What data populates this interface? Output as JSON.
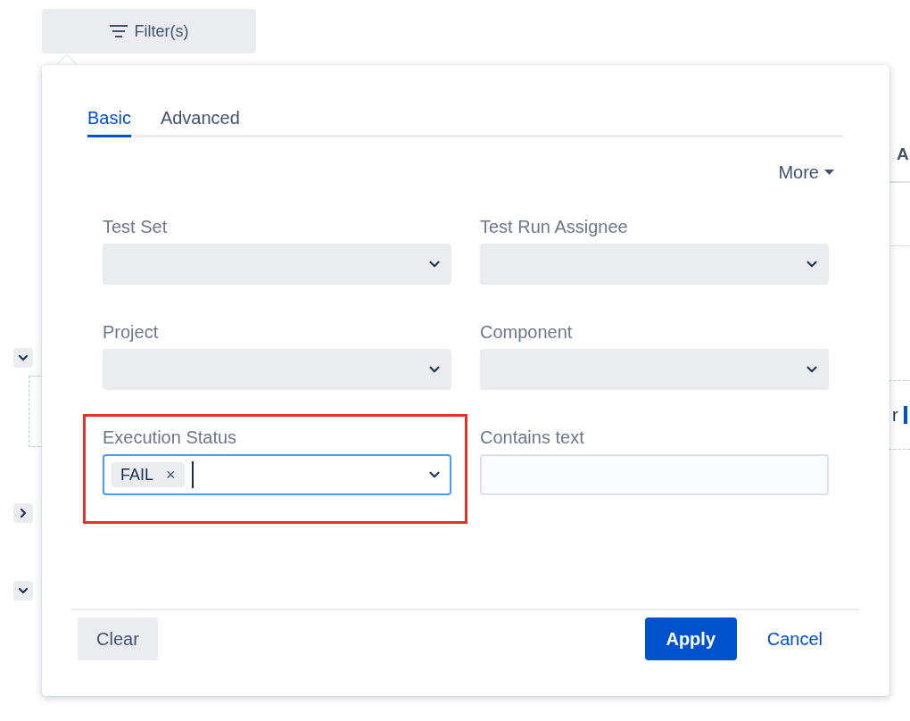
{
  "filter_button": {
    "label": "Filter(s)"
  },
  "background": {
    "column_header": "A",
    "text": "r",
    "row_toggles": [
      {
        "expanded": true
      },
      {
        "expanded": false
      },
      {
        "expanded": true
      }
    ]
  },
  "popover": {
    "tabs": [
      {
        "label": "Basic",
        "selected": true
      },
      {
        "label": "Advanced",
        "selected": false
      }
    ],
    "more": "More",
    "fields": [
      {
        "label": "Test Set",
        "kind": "select"
      },
      {
        "label": "Test Run Assignee",
        "kind": "select"
      },
      {
        "label": "Project",
        "kind": "select"
      },
      {
        "label": "Component",
        "kind": "select"
      },
      {
        "label": "Execution Status",
        "kind": "multiselect",
        "focused": true,
        "highlighted": true,
        "tags": [
          {
            "label": "FAIL",
            "remove": "×"
          }
        ]
      },
      {
        "label": "Contains text",
        "kind": "text"
      }
    ],
    "buttons": [
      {
        "label": "Clear",
        "kind": "secondary"
      },
      {
        "label": "Apply",
        "kind": "primary"
      },
      {
        "label": "Cancel",
        "kind": "link"
      }
    ]
  }
}
